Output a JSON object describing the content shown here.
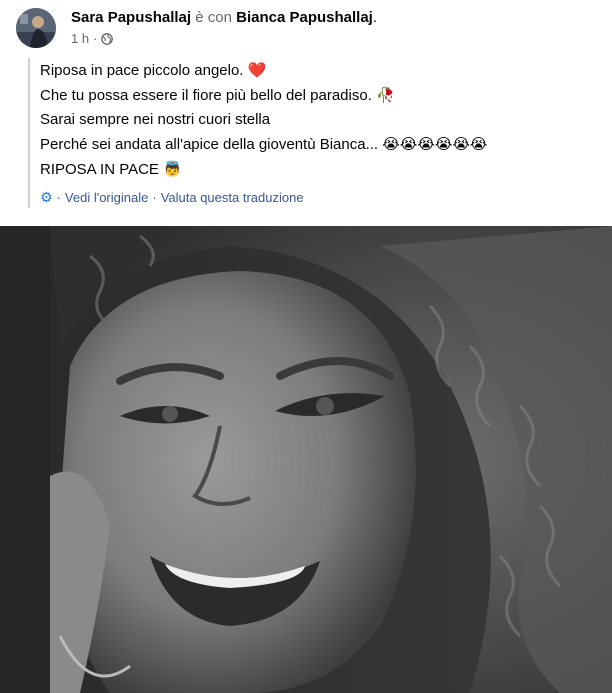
{
  "post": {
    "author": "Sara Papushallaj",
    "with_text": "è con",
    "tagged": "Bianca Papushallaj",
    "tagged_suffix": ".",
    "time": "1 h",
    "dot": "·",
    "lines": [
      {
        "text": "Riposa in pace piccolo angelo. ",
        "emoji": "❤️"
      },
      {
        "text": "Che tu possa essere il fiore più bello del paradiso. ",
        "emoji": "🥀"
      },
      {
        "text": "Sarai sempre nei nostri cuori stella",
        "emoji": ""
      },
      {
        "text": "Perché sei andata all'apice della gioventù Bianca... ",
        "emoji": "😭😭😭😭😭😭"
      },
      {
        "text": "RIPOSA IN PACE ",
        "emoji": "👼"
      }
    ],
    "translation": {
      "gear_icon": "gear-icon",
      "see_original": "Vedi l'originale",
      "rate": "Valuta questa traduzione",
      "sep": "·"
    }
  },
  "colors": {
    "link": "#385898",
    "muted": "#65676b",
    "photo_bg": "#242526"
  }
}
